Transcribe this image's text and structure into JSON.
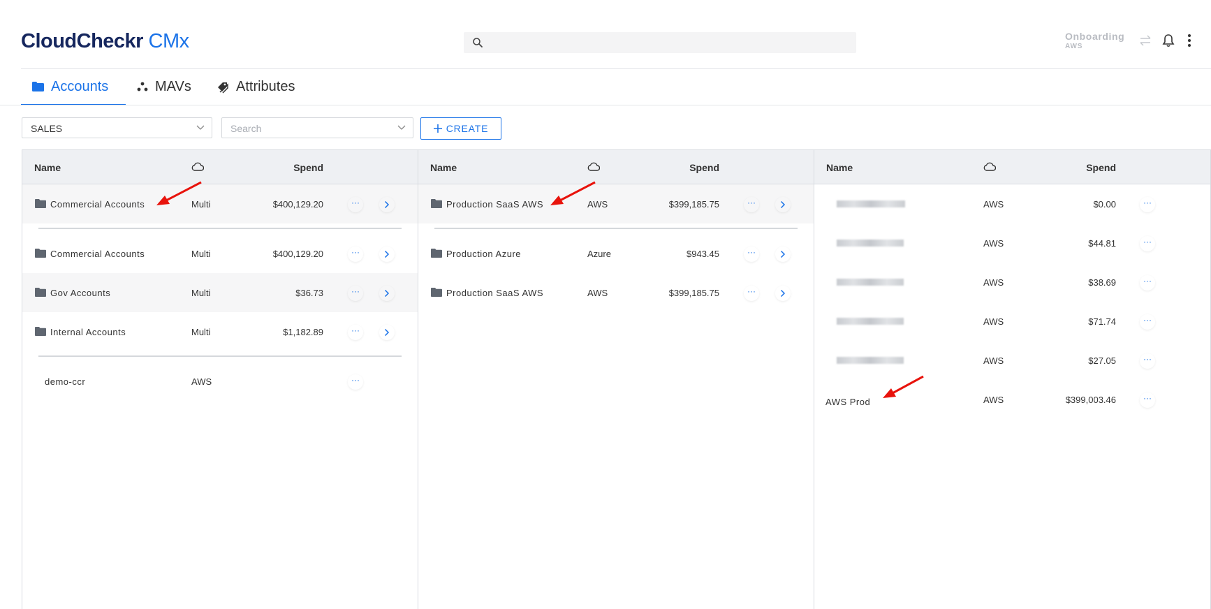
{
  "header": {
    "logo_part1": "CloudCheckr",
    "logo_part2": "CMx",
    "search_placeholder": "",
    "onboarding_label": "Onboarding",
    "onboarding_sub": "AWS"
  },
  "tabs": [
    {
      "label": "Accounts",
      "active": true
    },
    {
      "label": "MAVs",
      "active": false
    },
    {
      "label": "Attributes",
      "active": false
    }
  ],
  "toolbar": {
    "selected_group": "SALES",
    "search_placeholder": "Search",
    "create_label": "CREATE"
  },
  "columns": [
    {
      "headers": {
        "name": "Name",
        "spend": "Spend"
      },
      "rows": [
        {
          "name": "Commercial Accounts",
          "cloud": "Multi",
          "spend": "$400,129.20",
          "more": "···"
        },
        {
          "name": "Commercial Accounts",
          "cloud": "Multi",
          "spend": "$400,129.20",
          "more": "···"
        },
        {
          "name": "Gov Accounts",
          "cloud": "Multi",
          "spend": "$36.73",
          "more": "···"
        },
        {
          "name": "Internal Accounts",
          "cloud": "Multi",
          "spend": "$1,182.89",
          "more": "···"
        },
        {
          "name": "demo-ccr",
          "cloud": "AWS",
          "spend": "",
          "more": "···"
        }
      ]
    },
    {
      "headers": {
        "name": "Name",
        "spend": "Spend"
      },
      "rows": [
        {
          "name": "Production SaaS AWS",
          "cloud": "AWS",
          "spend": "$399,185.75",
          "more": "···"
        },
        {
          "name": "Production Azure",
          "cloud": "Azure",
          "spend": "$943.45",
          "more": "···"
        },
        {
          "name": "Production SaaS AWS",
          "cloud": "AWS",
          "spend": "$399,185.75",
          "more": "···"
        }
      ]
    },
    {
      "headers": {
        "name": "Name",
        "spend": "Spend"
      },
      "rows": [
        {
          "name": "",
          "cloud": "AWS",
          "spend": "$0.00",
          "more": "···"
        },
        {
          "name": "",
          "cloud": "AWS",
          "spend": "$44.81",
          "more": "···"
        },
        {
          "name": "",
          "cloud": "AWS",
          "spend": "$38.69",
          "more": "···"
        },
        {
          "name": "",
          "cloud": "AWS",
          "spend": "$71.74",
          "more": "···"
        },
        {
          "name": "",
          "cloud": "AWS",
          "spend": "$27.05",
          "more": "···"
        },
        {
          "name": "AWS Prod",
          "cloud": "AWS",
          "spend": "$399,003.46",
          "more": "···"
        }
      ]
    }
  ],
  "colors": {
    "accent": "#1b73e8",
    "brand_dark": "#16275e",
    "annotation": "#e8130c"
  }
}
